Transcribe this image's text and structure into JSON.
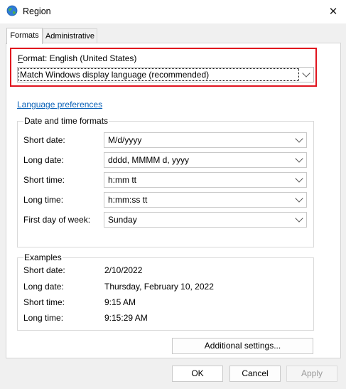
{
  "window": {
    "title": "Region",
    "close_glyph": "✕"
  },
  "tabs": [
    {
      "label": "Formats",
      "active": true
    },
    {
      "label": "Administrative",
      "active": false
    }
  ],
  "format": {
    "label_prefix": "F",
    "label_rest": "ormat: English (United States)",
    "selected_value": "Match Windows display language (recommended)",
    "highlight_color": "#e0141e"
  },
  "language_link": "Language preferences",
  "date_time": {
    "legend": "Date and time formats",
    "rows": [
      {
        "label": "Short date:",
        "value": "M/d/yyyy"
      },
      {
        "label": "Long date:",
        "value": "dddd, MMMM d, yyyy"
      },
      {
        "label": "Short time:",
        "value": "h:mm tt"
      },
      {
        "label": "Long time:",
        "value": "h:mm:ss tt"
      },
      {
        "label": "First day of week:",
        "value": "Sunday"
      }
    ]
  },
  "examples": {
    "legend": "Examples",
    "rows": [
      {
        "label": "Short date:",
        "value": "2/10/2022"
      },
      {
        "label": "Long date:",
        "value": "Thursday, February 10, 2022"
      },
      {
        "label": "Short time:",
        "value": "9:15 AM"
      },
      {
        "label": "Long time:",
        "value": "9:15:29 AM"
      }
    ]
  },
  "buttons": {
    "additional": "Additional settings...",
    "ok": "OK",
    "cancel": "Cancel",
    "apply": "Apply"
  },
  "colors": {
    "link": "#0b62b8",
    "window_bg": "#f0f0f0"
  },
  "icons": {
    "app": "globe-icon",
    "close": "close-icon",
    "dropdown": "chevron-down-icon"
  }
}
